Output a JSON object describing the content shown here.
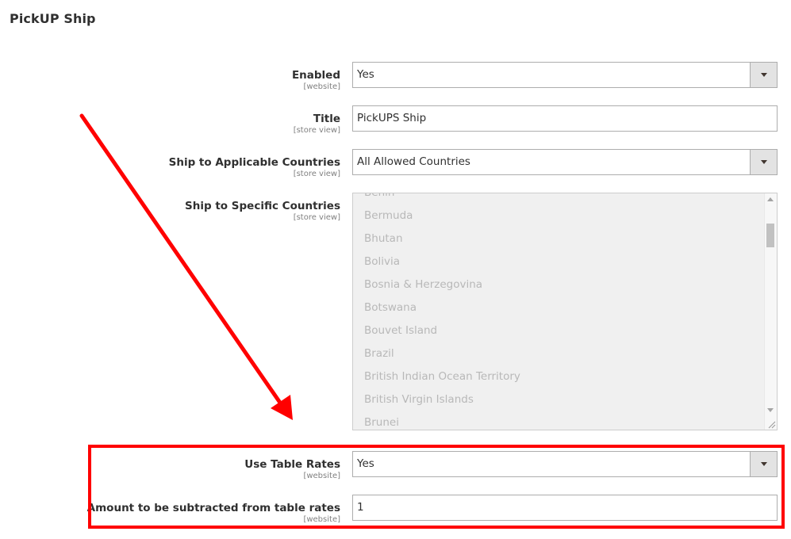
{
  "section": {
    "title": "PickUP Ship"
  },
  "fields": {
    "enabled": {
      "label": "Enabled",
      "scope": "[website]",
      "value": "Yes"
    },
    "title": {
      "label": "Title",
      "scope": "[store view]",
      "value": "PickUPS Ship"
    },
    "applicable_countries": {
      "label": "Ship to Applicable Countries",
      "scope": "[store view]",
      "value": "All Allowed Countries"
    },
    "specific_countries": {
      "label": "Ship to Specific Countries",
      "scope": "[store view]",
      "options": [
        "Benin",
        "Bermuda",
        "Bhutan",
        "Bolivia",
        "Bosnia & Herzegovina",
        "Botswana",
        "Bouvet Island",
        "Brazil",
        "British Indian Ocean Territory",
        "British Virgin Islands",
        "Brunei"
      ]
    },
    "use_table_rates": {
      "label": "Use Table Rates",
      "scope": "[website]",
      "value": "Yes"
    },
    "amount_subtracted": {
      "label": "Amount to be subtracted from table rates",
      "scope": "[website]",
      "value": "1"
    }
  },
  "icons": {
    "select_arrow": "chevron-down-icon",
    "scroll_up": "scroll-up-arrow-icon",
    "scroll_down": "scroll-down-arrow-icon",
    "resize": "resize-grip-icon",
    "annotation_arrow": "red-arrow-icon"
  },
  "colors": {
    "annotation": "#ff0000",
    "border": "#adadad",
    "disabled_bg": "#f0f0f0",
    "disabled_text": "#b8b8b8"
  }
}
